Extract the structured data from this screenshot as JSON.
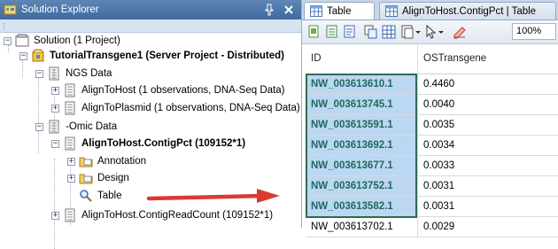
{
  "explorer": {
    "title": "Solution Explorer",
    "tree": [
      {
        "label": "Solution (1 Project)",
        "bold": false,
        "expander": "minus",
        "icon": "solution-icon"
      },
      {
        "label": "TutorialTransgene1 (Server Project - Distributed)",
        "bold": true,
        "expander": "minus",
        "icon": "project-icon"
      },
      {
        "label": "NGS Data",
        "bold": false,
        "expander": "minus",
        "icon": "data-folder-icon"
      },
      {
        "label": "AlignToHost (1 observations, DNA-Seq Data)",
        "bold": false,
        "expander": "plus",
        "icon": "dataset-icon"
      },
      {
        "label": "AlignToPlasmid (1 observations, DNA-Seq Data)",
        "bold": false,
        "expander": "plus",
        "icon": "dataset-icon"
      },
      {
        "label": "-Omic Data",
        "bold": false,
        "expander": "minus",
        "icon": "data-folder-icon"
      },
      {
        "label": "AlignToHost.ContigPct  (109152*1)",
        "bold": true,
        "expander": "minus",
        "icon": "dataset-icon"
      },
      {
        "label": "Annotation",
        "bold": false,
        "expander": "plus",
        "icon": "folder-icon"
      },
      {
        "label": "Design",
        "bold": false,
        "expander": "plus",
        "icon": "folder-icon"
      },
      {
        "label": "Table",
        "bold": false,
        "expander": "none",
        "icon": "magnifier-icon"
      },
      {
        "label": "AlignToHost.ContigReadCount  (109152*1)",
        "bold": false,
        "expander": "plus",
        "icon": "dataset-icon"
      }
    ]
  },
  "tabs": [
    {
      "label": "Table",
      "active": true,
      "icon": "table-icon"
    },
    {
      "label": "AlignToHost.ContigPct | Table",
      "active": false,
      "icon": "table-icon"
    }
  ],
  "toolbar": {
    "zoom": "100%"
  },
  "table": {
    "columns": [
      "ID",
      "OSTransgene"
    ],
    "rows": [
      {
        "id": "NW_003613610.1",
        "value": "0.4460",
        "selected": true
      },
      {
        "id": "NW_003613745.1",
        "value": "0.0040",
        "selected": true
      },
      {
        "id": "NW_003613591.1",
        "value": "0.0035",
        "selected": true
      },
      {
        "id": "NW_003613692.1",
        "value": "0.0034",
        "selected": true
      },
      {
        "id": "NW_003613677.1",
        "value": "0.0033",
        "selected": true
      },
      {
        "id": "NW_003613752.1",
        "value": "0.0031",
        "selected": true
      },
      {
        "id": "NW_003613582.1",
        "value": "0.0031",
        "selected": true
      },
      {
        "id": "NW_003613702.1",
        "value": "0.0029",
        "selected": false
      }
    ]
  },
  "colors": {
    "arrow": "#d93a33",
    "selection_border": "#2f6b52",
    "selection_fill": "#bcd7f1",
    "titlebar": "#4a74a9"
  }
}
